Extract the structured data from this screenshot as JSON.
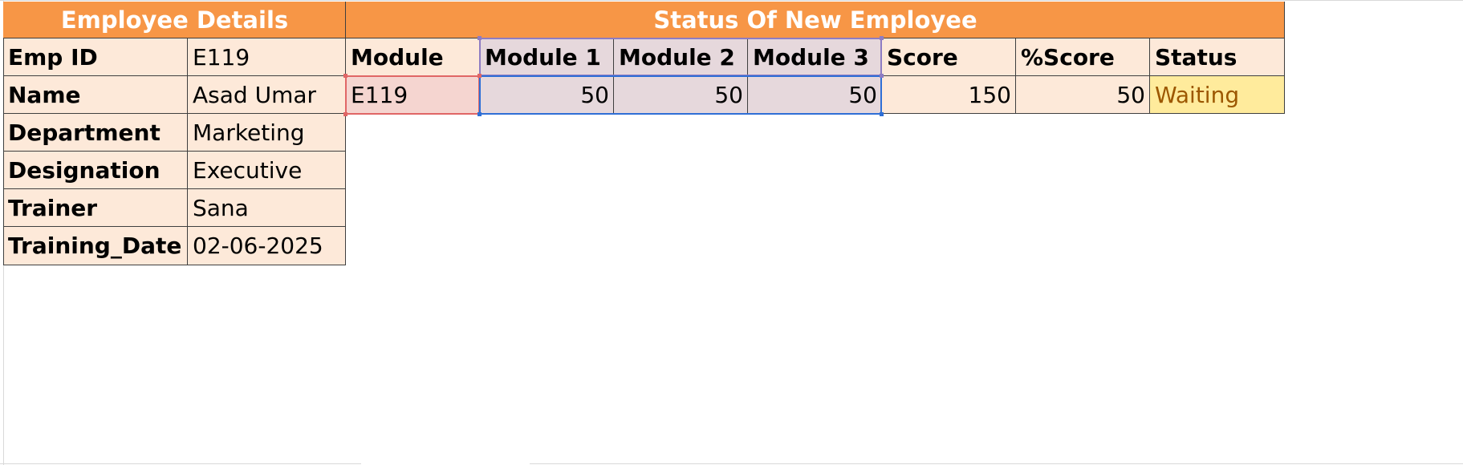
{
  "sheet": {
    "employee_details": {
      "header": "Employee Details",
      "rows": [
        {
          "label": "Emp ID",
          "value": "E119"
        },
        {
          "label": "Name",
          "value": "Asad Umar"
        },
        {
          "label": "Department",
          "value": "Marketing"
        },
        {
          "label": "Designation",
          "value": "Executive"
        },
        {
          "label": "Trainer",
          "value": "Sana"
        },
        {
          "label": "Training_Date",
          "value": "02-06-2025"
        }
      ]
    },
    "status": {
      "header": "Status Of New Employee",
      "columns": [
        "Module",
        "Module 1",
        "Module 2",
        "Module 3",
        "Score",
        "%Score",
        "Status"
      ],
      "row": {
        "module": "E119",
        "module1": "50",
        "module2": "50",
        "module3": "50",
        "score": "150",
        "pct_score": "50",
        "status": "Waiting"
      }
    },
    "colors": {
      "header_bg": "#f79646",
      "cell_bg": "#fde9d9",
      "status_bg": "#ffeb9c",
      "status_text": "#9c5700",
      "ref_red": "#e06666",
      "ref_purple": "#8e7cc3",
      "ref_blue": "#2f6fd6"
    }
  }
}
